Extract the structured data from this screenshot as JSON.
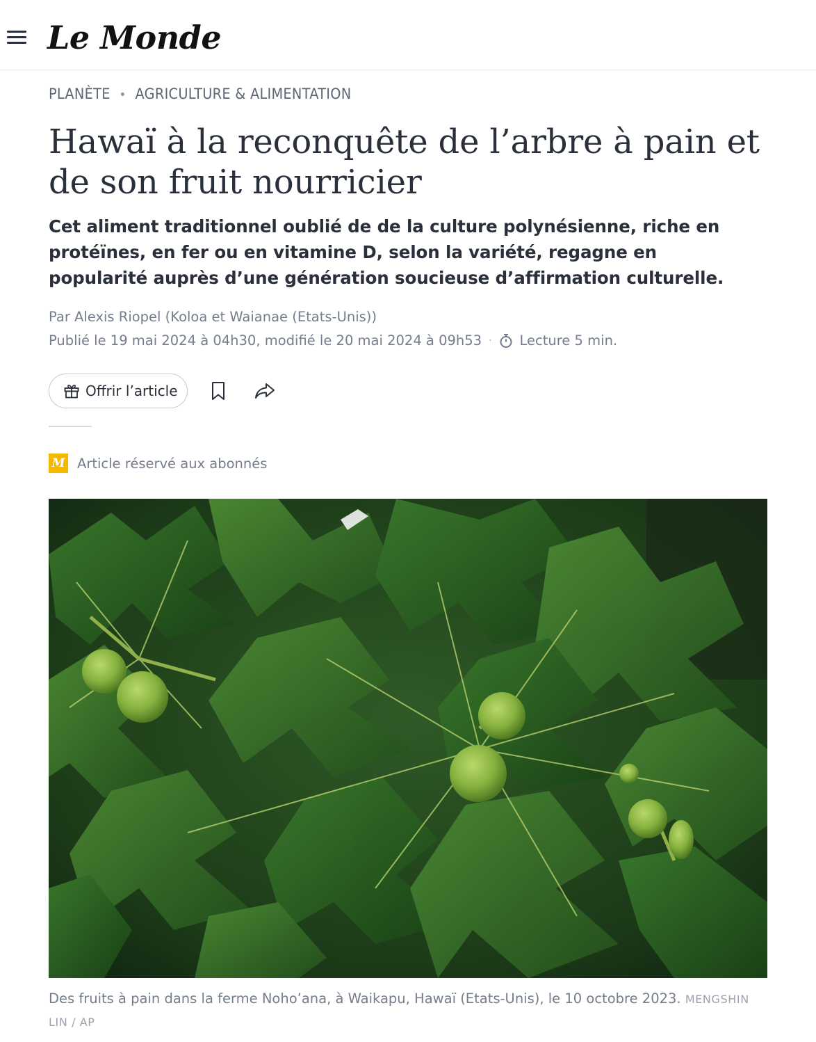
{
  "header": {
    "logo": "Le Monde",
    "menu_icon": "hamburger-menu-icon"
  },
  "breadcrumb": {
    "section": "PLANÈTE",
    "separator": "•",
    "subsection": "AGRICULTURE & ALIMENTATION"
  },
  "article": {
    "title": "Hawaï à la reconquête de l’arbre à pain et de son fruit nourricier",
    "lede": "Cet aliment traditionnel oublié de de la culture polynésienne, riche en protéïnes, en fer ou en vitamine D, selon la variété, regagne en popularité auprès d’une génération soucieuse d’affirmation culturelle.",
    "author": "Par Alexis Riopel (Koloa et Waianae (Etats-Unis))",
    "published": "Publié le 19 mai 2024 à 04h30, modifié le 20 mai 2024 à 09h53",
    "dot": "·",
    "reading_time": "Lecture 5 min."
  },
  "actions": {
    "offer_label": "Offrir l’article",
    "offer_icon": "gift-icon",
    "bookmark_icon": "bookmark-icon",
    "share_icon": "share-icon"
  },
  "subscriber": {
    "badge": "M",
    "label": "Article réservé aux abonnés"
  },
  "photo": {
    "caption": "Des fruits à pain dans la ferme Noho’ana, à Waikapu, Hawaï (Etats-Unis), le 10 octobre 2023.",
    "credit": "MENGSHIN LIN / AP"
  },
  "colors": {
    "text": "#2a303b",
    "muted": "#747d8c",
    "badge": "#f5b800"
  }
}
